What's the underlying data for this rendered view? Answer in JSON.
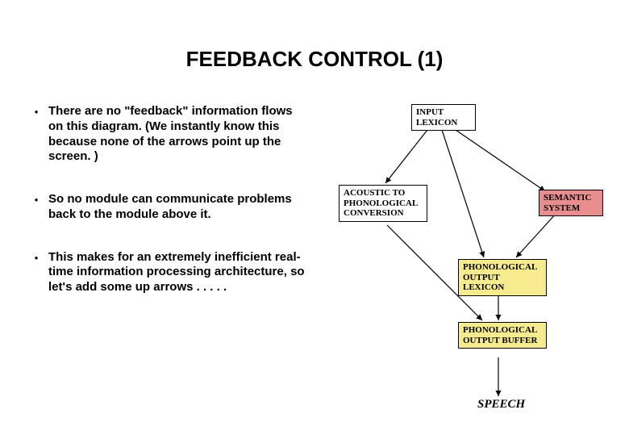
{
  "title": "FEEDBACK CONTROL (1)",
  "bullets": [
    "There are no \"feedback\" information flows on this diagram. (We instantly know this because none of the arrows point up the screen. )",
    "So no module can communicate problems back to the module above it.",
    "This makes for an extremely inefficient real-time information processing architecture, so let's add some up arrows . . . . ."
  ],
  "diagram": {
    "boxes": {
      "input_lexicon": "INPUT LEXICON",
      "acoustic": "ACOUSTIC TO PHONOLOGICAL CONVERSION",
      "semantic": "SEMANTIC SYSTEM",
      "pol": "PHONOLOGICAL OUTPUT LEXICON",
      "pob": "PHONOLOGICAL OUTPUT BUFFER"
    },
    "speech": "SPEECH"
  }
}
